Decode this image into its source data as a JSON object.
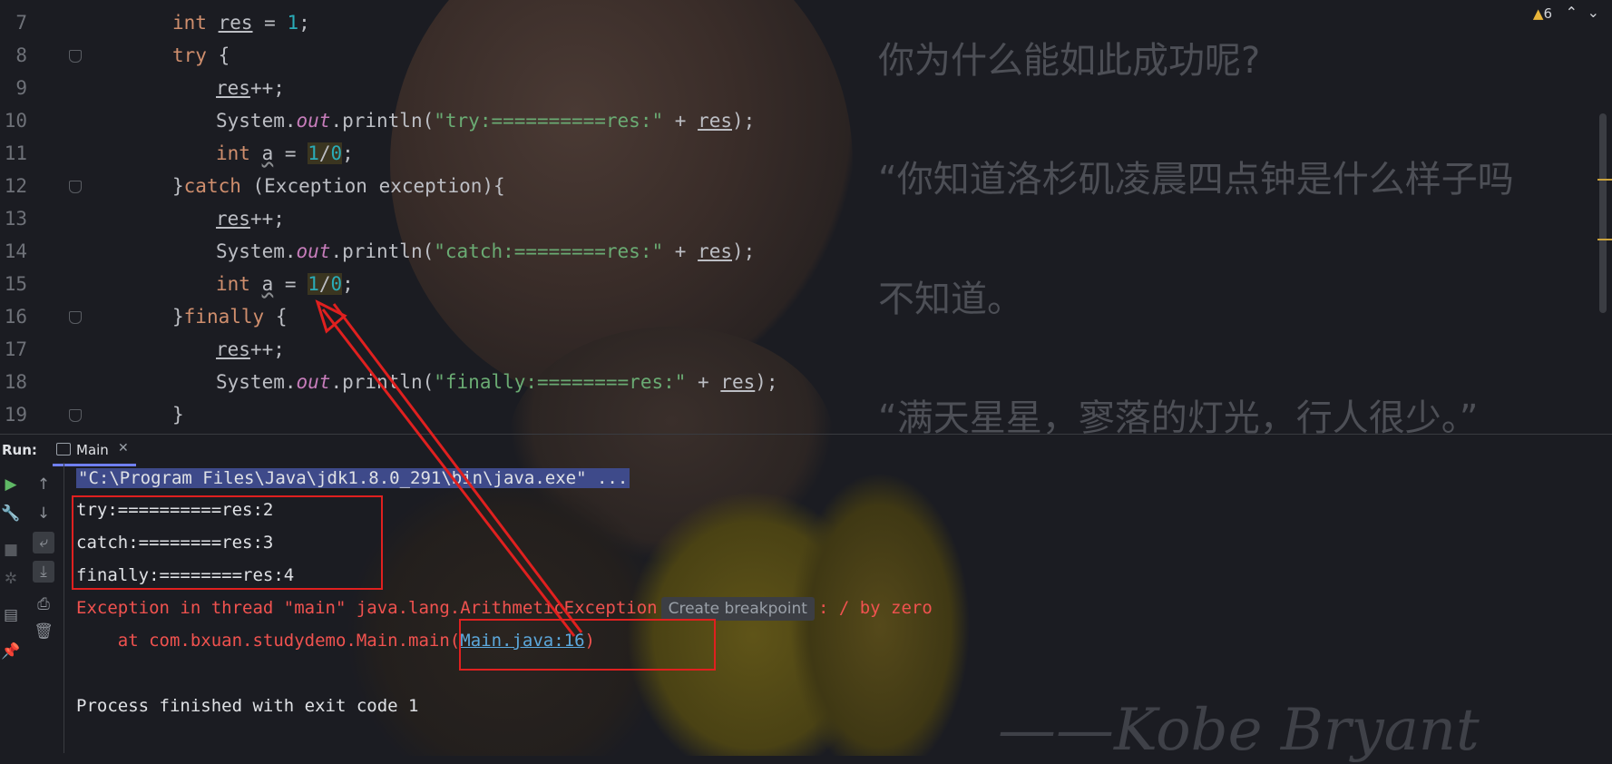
{
  "editor": {
    "lines": [
      {
        "n": "7"
      },
      {
        "n": "8"
      },
      {
        "n": "9"
      },
      {
        "n": "10"
      },
      {
        "n": "11"
      },
      {
        "n": "12"
      },
      {
        "n": "13"
      },
      {
        "n": "14"
      },
      {
        "n": "15"
      },
      {
        "n": "16"
      },
      {
        "n": "17"
      },
      {
        "n": "18"
      },
      {
        "n": "19"
      }
    ],
    "tokens": {
      "int": "int",
      "res": "res",
      "eq": " = ",
      "one": "1",
      "semi": ";",
      "try": "try",
      "lbrace": " {",
      "plusplus": "++;",
      "system": "System.",
      "out": "out",
      "println": ".println(",
      "str_try": "\"try:==========res:\"",
      "plus": " + ",
      "close": ");",
      "a": "a",
      "slash": "/",
      "zero": "0",
      "catch_open": "}",
      "catch": "catch",
      "catch_rest": " (Exception exception){",
      "str_catch": "\"catch:========res:\"",
      "finally_open": "}",
      "finally": "finally",
      "finally_rest": " {",
      "str_finally": "\"finally:========res:\"",
      "rbrace": "}"
    },
    "warnings": {
      "count": "6",
      "icon": "warning-triangle-icon"
    }
  },
  "wallpaper_text": {
    "q1": "你为什么能如此成功呢?",
    "q2": "“你知道洛杉矶凌晨四点钟是什么样子吗",
    "q3": "不知道。",
    "q4": "“满天星星，寥落的灯光，行人很少。”",
    "signature": "——Kobe Bryant"
  },
  "run_panel": {
    "label": "Run:",
    "tab_label": "Main",
    "close": "✕",
    "console": {
      "cmd": "\"C:\\Program Files\\Java\\jdk1.8.0_291\\bin\\java.exe\" ...",
      "out1": "try:==========res:2",
      "out2": "catch:========res:3",
      "out3": "finally:========res:4",
      "err_prefix": "Exception in thread \"main\" java.lang.ArithmeticException",
      "create_breakpoint": "Create breakpoint",
      "err_suffix": ": / by zero",
      "trace_prefix": "    at com.bxuan.studydemo.Main.main(",
      "trace_link": "Main.java:16",
      "trace_suffix": ")",
      "exit": "Process finished with exit code 1"
    }
  },
  "colors": {
    "annotation_red": "#e0201f",
    "error": "#f0524f",
    "keyword": "#cf8e6d",
    "string": "#6aab73",
    "number": "#2aacb8"
  }
}
